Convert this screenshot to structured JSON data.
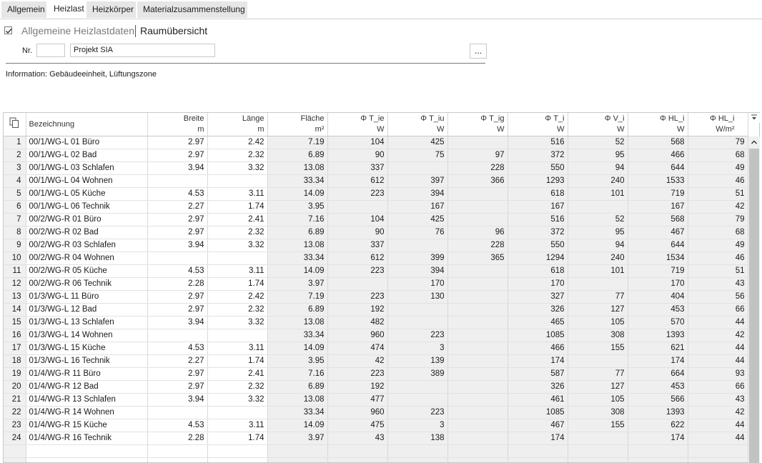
{
  "tabs": [
    "Allgemein",
    "Heizlast",
    "Heizkörper",
    "Materialzusammenstellung"
  ],
  "active_tab": 1,
  "section": {
    "inactive_title": "Allgemeine Heizlastdaten",
    "active_title": "Raumübersicht"
  },
  "form": {
    "nr_label": "Nr.",
    "nr_value": "",
    "project_value": "Projekt SIA",
    "dots_label": "..."
  },
  "info_text": "Information: Gebäudeeinheit, Lüftungszone",
  "table": {
    "columns": [
      {
        "name": "Bezeichnung",
        "unit": ""
      },
      {
        "name": "Breite",
        "unit": "m"
      },
      {
        "name": "Länge",
        "unit": "m"
      },
      {
        "name": "Fläche",
        "unit": "m²"
      },
      {
        "name": "Φ T_ie",
        "unit": "W"
      },
      {
        "name": "Φ T_iu",
        "unit": "W"
      },
      {
        "name": "Φ T_ig",
        "unit": "W"
      },
      {
        "name": "Φ T_i",
        "unit": "W"
      },
      {
        "name": "Φ V_i",
        "unit": "W"
      },
      {
        "name": "Φ HL_i",
        "unit": "W"
      },
      {
        "name": "Φ HL_i",
        "unit": "W/m²"
      }
    ],
    "rows": [
      [
        "1",
        "00/1/WG-L 01 Büro",
        "2.97",
        "2.42",
        "7.19",
        "104",
        "425",
        "",
        "516",
        "52",
        "568",
        "79"
      ],
      [
        "2",
        "00/1/WG-L 02 Bad",
        "2.97",
        "2.32",
        "6.89",
        "90",
        "75",
        "97",
        "372",
        "95",
        "466",
        "68"
      ],
      [
        "3",
        "00/1/WG-L 03 Schlafen",
        "3.94",
        "3.32",
        "13.08",
        "337",
        "",
        "228",
        "550",
        "94",
        "644",
        "49"
      ],
      [
        "4",
        "00/1/WG-L 04 Wohnen",
        "",
        "",
        "33.34",
        "612",
        "397",
        "366",
        "1293",
        "240",
        "1533",
        "46"
      ],
      [
        "5",
        "00/1/WG-L 05 Küche",
        "4.53",
        "3.11",
        "14.09",
        "223",
        "394",
        "",
        "618",
        "101",
        "719",
        "51"
      ],
      [
        "6",
        "00/1/WG-L 06 Technik",
        "2.27",
        "1.74",
        "3.95",
        "",
        "167",
        "",
        "167",
        "",
        "167",
        "42"
      ],
      [
        "7",
        "00/2/WG-R 01 Büro",
        "2.97",
        "2.41",
        "7.16",
        "104",
        "425",
        "",
        "516",
        "52",
        "568",
        "79"
      ],
      [
        "8",
        "00/2/WG-R 02 Bad",
        "2.97",
        "2.32",
        "6.89",
        "90",
        "76",
        "96",
        "372",
        "95",
        "467",
        "68"
      ],
      [
        "9",
        "00/2/WG-R 03 Schlafen",
        "3.94",
        "3.32",
        "13.08",
        "337",
        "",
        "228",
        "550",
        "94",
        "644",
        "49"
      ],
      [
        "10",
        "00/2/WG-R 04 Wohnen",
        "",
        "",
        "33.34",
        "612",
        "399",
        "365",
        "1294",
        "240",
        "1534",
        "46"
      ],
      [
        "11",
        "00/2/WG-R 05 Küche",
        "4.53",
        "3.11",
        "14.09",
        "223",
        "394",
        "",
        "618",
        "101",
        "719",
        "51"
      ],
      [
        "12",
        "00/2/WG-R 06 Technik",
        "2.28",
        "1.74",
        "3.97",
        "",
        "170",
        "",
        "170",
        "",
        "170",
        "43"
      ],
      [
        "13",
        "01/3/WG-L 11 Büro",
        "2.97",
        "2.42",
        "7.19",
        "223",
        "130",
        "",
        "327",
        "77",
        "404",
        "56"
      ],
      [
        "14",
        "01/3/WG-L 12 Bad",
        "2.97",
        "2.32",
        "6.89",
        "192",
        "",
        "",
        "326",
        "127",
        "453",
        "66"
      ],
      [
        "15",
        "01/3/WG-L 13 Schlafen",
        "3.94",
        "3.32",
        "13.08",
        "482",
        "",
        "",
        "465",
        "105",
        "570",
        "44"
      ],
      [
        "16",
        "01/3/WG-L 14 Wohnen",
        "",
        "",
        "33.34",
        "960",
        "223",
        "",
        "1085",
        "308",
        "1393",
        "42"
      ],
      [
        "17",
        "01/3/WG-L 15 Küche",
        "4.53",
        "3.11",
        "14.09",
        "474",
        "3",
        "",
        "466",
        "155",
        "621",
        "44"
      ],
      [
        "18",
        "01/3/WG-L 16 Technik",
        "2.27",
        "1.74",
        "3.95",
        "42",
        "139",
        "",
        "174",
        "",
        "174",
        "44"
      ],
      [
        "19",
        "01/4/WG-R 11 Büro",
        "2.97",
        "2.41",
        "7.16",
        "223",
        "389",
        "",
        "587",
        "77",
        "664",
        "93"
      ],
      [
        "20",
        "01/4/WG-R 12 Bad",
        "2.97",
        "2.32",
        "6.89",
        "192",
        "",
        "",
        "326",
        "127",
        "453",
        "66"
      ],
      [
        "21",
        "01/4/WG-R 13 Schlafen",
        "3.94",
        "3.32",
        "13.08",
        "477",
        "",
        "",
        "461",
        "105",
        "566",
        "43"
      ],
      [
        "22",
        "01/4/WG-R 14 Wohnen",
        "",
        "",
        "33.34",
        "960",
        "223",
        "",
        "1085",
        "308",
        "1393",
        "42"
      ],
      [
        "23",
        "01/4/WG-R 15 Küche",
        "4.53",
        "3.11",
        "14.09",
        "475",
        "3",
        "",
        "467",
        "155",
        "622",
        "44"
      ],
      [
        "24",
        "01/4/WG-R 16 Technik",
        "2.28",
        "1.74",
        "3.97",
        "43",
        "138",
        "",
        "174",
        "",
        "174",
        "44"
      ]
    ]
  }
}
